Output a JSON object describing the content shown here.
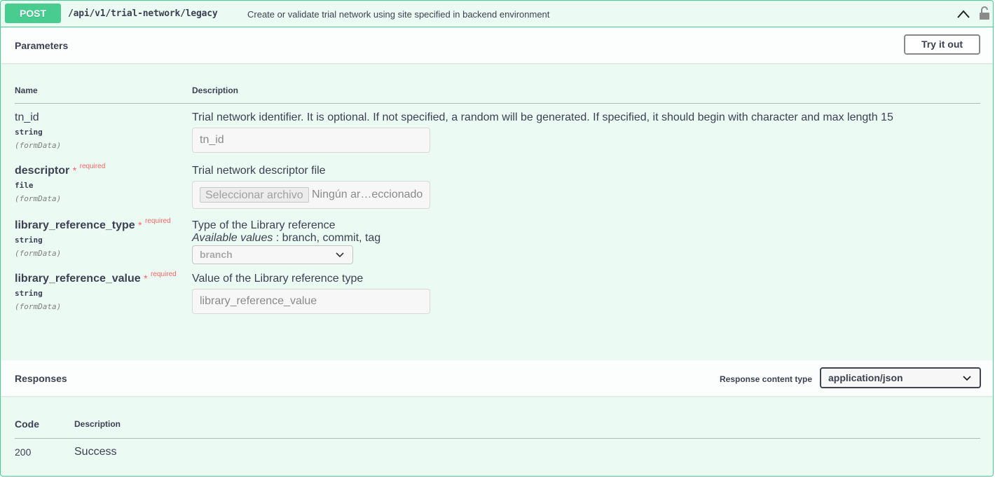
{
  "operation": {
    "method": "POST",
    "path": "/api/v1/trial-network/legacy",
    "summary": "Create or validate trial network using site specified in backend environment"
  },
  "parameters": {
    "title": "Parameters",
    "try_label": "Try it out",
    "col_name": "Name",
    "col_description": "Description",
    "items": [
      {
        "name": "tn_id",
        "type": "string",
        "in": "(formData)",
        "description": "Trial network identifier. It is optional. If not specified, a random will be generated. If specified, it should begin with character and max length 15",
        "placeholder": "tn_id"
      },
      {
        "name": "descriptor",
        "star": "*",
        "required": "required",
        "type": "file",
        "in": "(formData)",
        "description": "Trial network descriptor file",
        "file_button": "Seleccionar archivo",
        "file_name": "Ningún ar…eccionado"
      },
      {
        "name": "library_reference_type",
        "star": "*",
        "required": "required",
        "type": "string",
        "in": "(formData)",
        "description": "Type of the Library reference",
        "available_label": "Available values",
        "available_values": " : branch, commit, tag",
        "selected": "branch"
      },
      {
        "name": "library_reference_value",
        "star": "*",
        "required": "required",
        "type": "string",
        "in": "(formData)",
        "description": "Value of the Library reference type",
        "placeholder": "library_reference_value"
      }
    ]
  },
  "responses": {
    "title": "Responses",
    "content_type_label": "Response content type",
    "content_type": "application/json",
    "col_code": "Code",
    "col_description": "Description",
    "rows": [
      {
        "code": "200",
        "description": "Success"
      }
    ]
  },
  "colors": {
    "post": "#49cc90",
    "required": "#ff6060"
  }
}
